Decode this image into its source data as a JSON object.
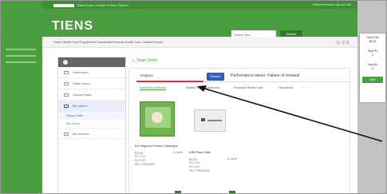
{
  "window": {
    "top_left_links": "Select Order Location ▾   Tiens Online ▾",
    "top_right_links": "Welcome back!   Log out   Cart"
  },
  "header": {
    "logo": "TIENS",
    "search_placeholder": "Search item",
    "search_button": "Search"
  },
  "breadcrumb": {
    "items": "Home   Health Food Supplement   Household   Personal Health Care   Limited Product",
    "cart_label": "🛒 0  Ⓡ"
  },
  "sidebar": {
    "items": [
      {
        "label": "Dashboard"
      },
      {
        "label": "Sales report"
      },
      {
        "label": "Upload Sales"
      },
      {
        "label": "My orders"
      },
      {
        "label": "My account"
      }
    ],
    "sub_items": [
      {
        "label": "Group Order"
      },
      {
        "label": "My orders"
      }
    ]
  },
  "main": {
    "title": "Team Order",
    "tabs": {
      "analysis": "Analysis",
      "button": "Search",
      "performance": "Performance owner: Failure of renewal"
    },
    "categories": [
      "Marketing Materials",
      "Health Food Supplement",
      "Personal Health Care",
      "Household"
    ],
    "products": [
      {
        "name": "EU Regional Product Catalogue",
        "price": "€3.00",
        "qty": "In stock",
        "pv": "PV: 0.00",
        "bv": "BV: 0.00",
        "sku": "SKU: PR0000007"
      },
      {
        "name": "USB Flash Disk",
        "price": "€5.00",
        "qty": "In stock",
        "pv": "PV: 0.00",
        "bv": "BV: 0.00",
        "sku": "SKU: PR0000035"
      }
    ]
  },
  "right_panel": {
    "total_price_label": "Total Price",
    "total_price": "€0.00",
    "total_pv_label": "Total PV",
    "total_pv": "0",
    "total_bv_label": "Total BV",
    "total_bv": "0",
    "next_button": "Next"
  },
  "colors": {
    "brand_green": "#4b9e3f",
    "accent_blue": "#2f5fbf",
    "price_red": "#d33"
  }
}
